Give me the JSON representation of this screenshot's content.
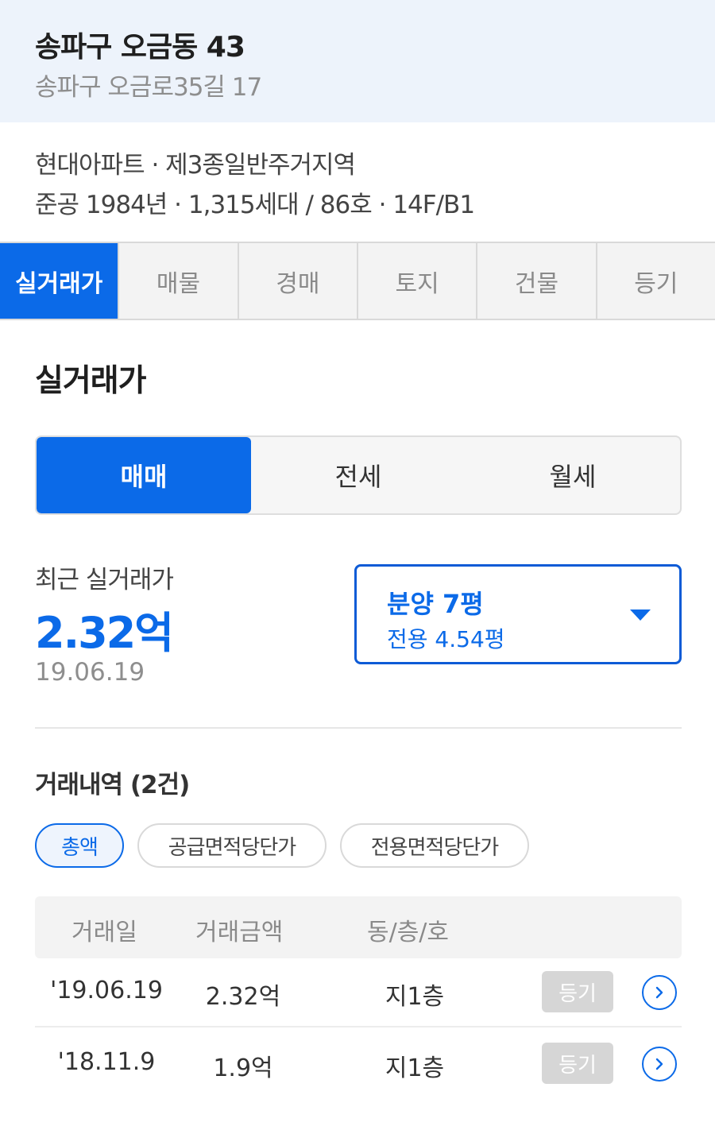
{
  "header": {
    "title": "송파구 오금동 43",
    "address": "송파구 오금로35길 17"
  },
  "info": {
    "line1": "현대아파트 · 제3종일반주거지역",
    "line2": "준공 1984년 · 1,315세대 / 86호 · 14F/B1"
  },
  "tabs": [
    {
      "label": "실거래가",
      "active": true
    },
    {
      "label": "매물",
      "active": false
    },
    {
      "label": "경매",
      "active": false
    },
    {
      "label": "토지",
      "active": false
    },
    {
      "label": "건물",
      "active": false
    },
    {
      "label": "등기",
      "active": false
    }
  ],
  "section_title": "실거래가",
  "segment": [
    {
      "label": "매매",
      "active": true
    },
    {
      "label": "전세",
      "active": false
    },
    {
      "label": "월세",
      "active": false
    }
  ],
  "recent": {
    "label": "최근 실거래가",
    "price": "2.32억",
    "date": "19.06.19"
  },
  "area_select": {
    "main": "분양 7평",
    "sub": "전용 4.54평",
    "icon": "caret-down-icon"
  },
  "history": {
    "title": "거래내역 (2건)",
    "filters": [
      {
        "label": "총액",
        "active": true
      },
      {
        "label": "공급면적당단가",
        "active": false
      },
      {
        "label": "전용면적당단가",
        "active": false
      }
    ],
    "columns": [
      "거래일",
      "거래금액",
      "동/층/호"
    ],
    "rows": [
      {
        "date": "'19.06.19",
        "amount": "2.32억",
        "floor": "지1층",
        "registry": "등기"
      },
      {
        "date": "'18.11.9",
        "amount": "1.9억",
        "floor": "지1층",
        "registry": "등기"
      }
    ]
  },
  "colors": {
    "accent": "#0b6ae8",
    "header_bg": "#edf3fb",
    "disabled_button": "#d6d6d6"
  }
}
